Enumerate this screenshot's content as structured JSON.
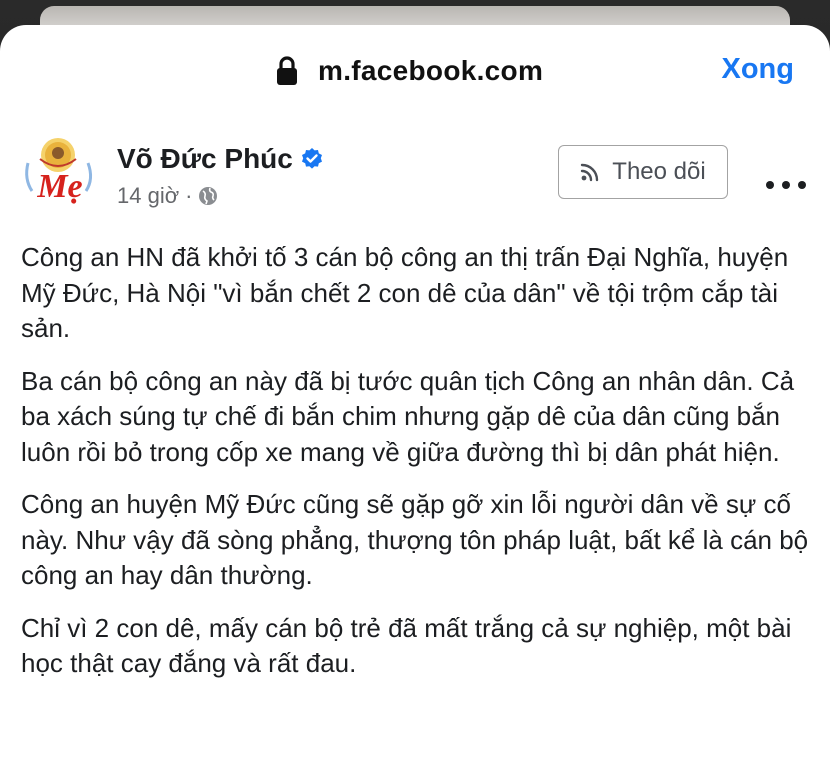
{
  "browser": {
    "url": "m.facebook.com",
    "done_label": "Xong"
  },
  "post": {
    "avatar_text": "Mẹ",
    "author": "Võ Đức Phúc",
    "time": "14 giờ",
    "separator": "·",
    "follow_label": "Theo dõi",
    "paragraphs": [
      "Công an HN đã khởi tố 3 cán bộ công an thị trấn Đại Nghĩa, huyện Mỹ Đức, Hà Nội \"vì bắn chết 2 con dê của dân\" về tội trộm cắp tài sản.",
      "Ba cán bộ công an này đã bị tước quân tịch Công an nhân dân. Cả ba xách súng tự chế đi bắn chim nhưng gặp dê của dân cũng bắn luôn rồi bỏ trong cốp xe mang về giữa đường thì bị dân phát hiện.",
      "Công an huyện Mỹ Đức cũng sẽ gặp gỡ xin lỗi người dân về sự cố này. Như vậy đã sòng phẳng, thượng tôn pháp luật, bất kể là cán bộ công an hay dân thường.",
      "Chỉ vì 2 con dê, mấy cán bộ trẻ đã mất trắng cả sự nghiệp, một bài học thật cay đắng và rất đau."
    ]
  },
  "icons": {
    "lock": "lock-icon",
    "verified": "verified-badge-icon",
    "globe": "globe-icon",
    "follow": "rss-icon",
    "more": "more-horizontal-icon"
  },
  "colors": {
    "link_blue": "#1877f2",
    "text": "#1c1e21",
    "meta_gray": "#65676b",
    "avatar_red": "#d6221d"
  }
}
